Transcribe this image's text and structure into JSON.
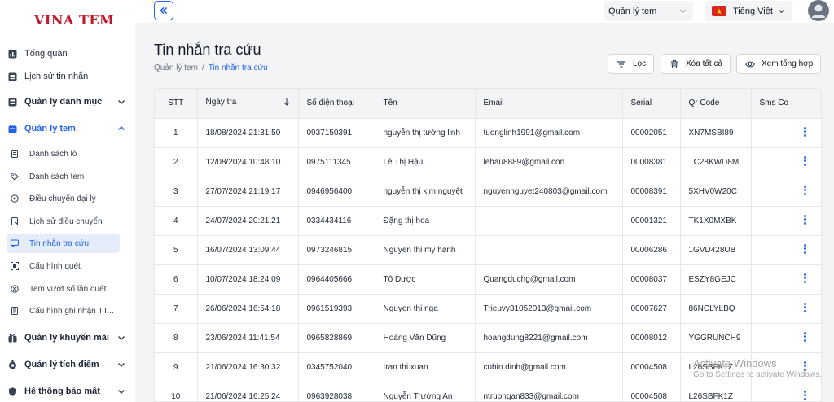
{
  "brand": {
    "logo_text": "VINA TEM",
    "logo_color": "#c0172b"
  },
  "sidebar": {
    "items": [
      {
        "label": "Tổng quan",
        "icon": "dashboard-icon"
      },
      {
        "label": "Lịch sử tin nhắn",
        "icon": "list-icon"
      },
      {
        "label": "Quản lý danh mục",
        "icon": "catalog-icon",
        "expanded": false
      },
      {
        "label": "Quản lý tem",
        "icon": "calendar-icon",
        "expanded": true,
        "children": [
          {
            "label": "Danh sách lô",
            "icon": "document-icon"
          },
          {
            "label": "Danh sách tem",
            "icon": "tag-icon"
          },
          {
            "label": "Điều chuyển đại lý",
            "icon": "transfer-icon"
          },
          {
            "label": "Lịch sử điều chuyển",
            "icon": "history-icon"
          },
          {
            "label": "Tin nhắn tra cứu",
            "icon": "message-icon",
            "active": true
          },
          {
            "label": "Cấu hình quét",
            "icon": "scan-icon"
          },
          {
            "label": "Tem vượt số lần quét",
            "icon": "warning-icon"
          },
          {
            "label": "Cấu hình ghi nhận TT...",
            "icon": "config-icon"
          }
        ]
      },
      {
        "label": "Quản lý khuyến mãi",
        "icon": "gift-icon",
        "expanded": false
      },
      {
        "label": "Quản lý tích điểm",
        "icon": "points-icon",
        "expanded": false
      },
      {
        "label": "Hệ thống bảo mật",
        "icon": "shield-icon",
        "expanded": false
      }
    ]
  },
  "topbar": {
    "module_select": "Quản lý tem",
    "language_select": "Tiếng Việt",
    "language_flag": "vietnam-flag-icon"
  },
  "page": {
    "title": "Tin nhắn tra cứu",
    "breadcrumb": [
      "Quản lý tem",
      "Tin nhắn tra cứu"
    ]
  },
  "actions": {
    "filter_label": "Lọc",
    "delete_all_label": "Xóa tất cả",
    "summary_label": "Xem tổng hợp"
  },
  "table": {
    "columns": [
      "STT",
      "Ngày tra",
      "Số điện thoại",
      "Tên",
      "Email",
      "Serial",
      "Qr Code",
      "Sms Co"
    ],
    "rows": [
      [
        "1",
        "18/08/2024 21:31:50",
        "0937150391",
        "nguyễn thị tường linh",
        "tuonglinh1991@gmail.com",
        "00002051",
        "XN7MSBI89",
        ""
      ],
      [
        "2",
        "12/08/2024 10:48:10",
        "0975111345",
        "Lê Thị Hậu",
        "lehau8889@gmail.con",
        "00008381",
        "TC28KWD8M",
        ""
      ],
      [
        "3",
        "27/07/2024 21:19:17",
        "0946956400",
        "nguyễn thị kim nguyệt",
        "nguyennguyet240803@gmail.com",
        "00008391",
        "5XHV0W20C",
        ""
      ],
      [
        "4",
        "24/07/2024 20:21:21",
        "0334434116",
        "Đặng thị hoa",
        "",
        "00001321",
        "TK1X0MXBK",
        ""
      ],
      [
        "5",
        "16/07/2024 13:09:44",
        "0973246815",
        "Nguyen thi my hanh",
        "",
        "00006286",
        "1GVD428UB",
        ""
      ],
      [
        "6",
        "10/07/2024 18:24:09",
        "0964405666",
        "Tô Dược",
        "Quangduchg@gmail.com",
        "00008037",
        "ESZY8GEJC",
        ""
      ],
      [
        "7",
        "26/06/2024 16:54:18",
        "0961519393",
        "Nguyen thi nga",
        "Trieuvy31052013@gmail.com",
        "00007627",
        "86NCLYLBQ",
        ""
      ],
      [
        "8",
        "23/06/2024 11:41:54",
        "0965828869",
        "Hoàng Văn Dũng",
        "hoangdung8221@gmail.com",
        "00008012",
        "YGGRUNCH9",
        ""
      ],
      [
        "9",
        "21/06/2024 16:30:32",
        "0345752040",
        "tran thi xuan",
        "cubin.dinh@gmail.com",
        "00004508",
        "L26SBFK1Z",
        ""
      ],
      [
        "10",
        "21/06/2024 16:25:24",
        "0963928038",
        "Nguyễn Trường An",
        "ntruongan833@gmail.com",
        "00004508",
        "L26SBFK1Z",
        ""
      ]
    ]
  },
  "watermark": {
    "line1": "Activate Windows",
    "line2": "Go to Settings to activate Windows."
  },
  "colors": {
    "accent": "#2563eb",
    "active_bg": "#e5edfb"
  }
}
